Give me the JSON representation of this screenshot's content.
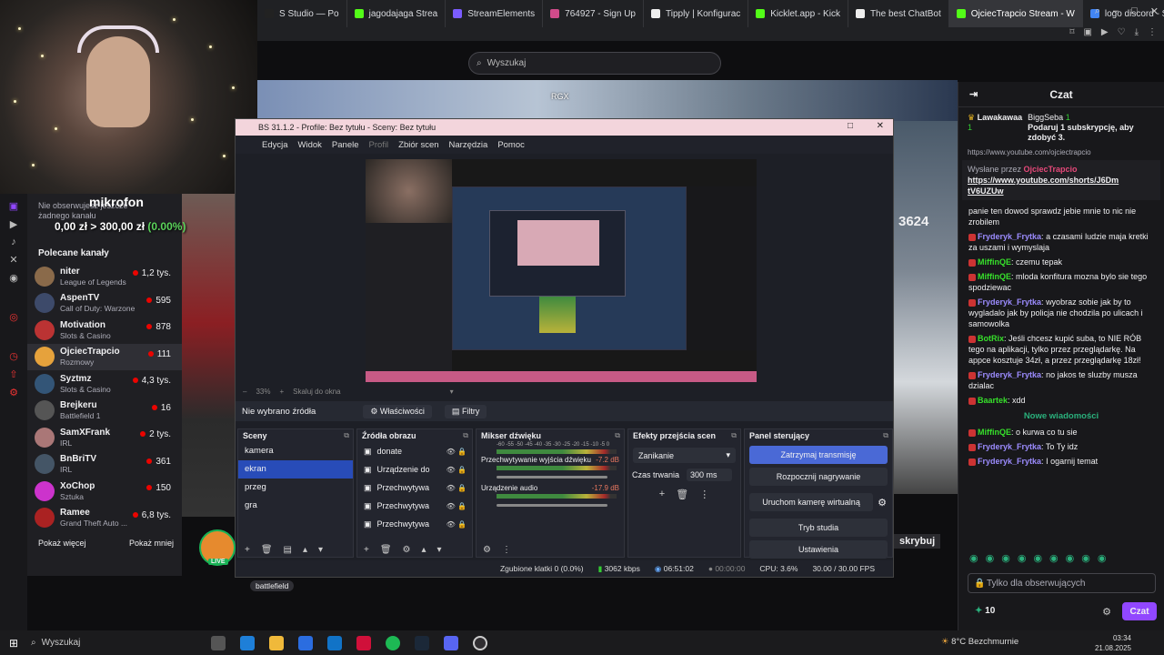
{
  "browser": {
    "tabs": [
      {
        "label": "S Studio — Po",
        "color": "#222"
      },
      {
        "label": "jagodajaga Strea",
        "color": "#53fc18"
      },
      {
        "label": "StreamElements",
        "color": "#7b5cff"
      },
      {
        "label": "764927 - Sign Up",
        "color": "#d04b8a"
      },
      {
        "label": "Tipply | Konfigurac",
        "color": "#eee"
      },
      {
        "label": "Kicklet.app - Kick",
        "color": "#53fc18"
      },
      {
        "label": "The best ChatBot",
        "color": "#eee"
      },
      {
        "label": "OjciecTrapcio Stream - W",
        "color": "#53fc18"
      },
      {
        "label": "logo discord - Sz",
        "color": "#4285f4"
      }
    ],
    "new_tab": "+"
  },
  "twitch": {
    "search_placeholder": "Wyszukaj",
    "mic_label": "mikrofon",
    "money": "0,00 zł > 300,00 zł",
    "money_pct": "(0.00%)",
    "not_following": "Nie obserwujesz jeszcze żadnego kanału",
    "recommended_title": "Polecane kanały",
    "channels": [
      {
        "name": "niter",
        "game": "League of Legends",
        "viewers": "1,2 tys.",
        "color": "#8a6a4a"
      },
      {
        "name": "AspenTV",
        "game": "Call of Duty: Warzone",
        "viewers": "595",
        "color": "#3d4a6a"
      },
      {
        "name": "Motivation",
        "game": "Slots & Casino",
        "viewers": "878",
        "color": "#b33"
      },
      {
        "name": "OjciecTrapcio",
        "game": "Rozmowy",
        "viewers": "111",
        "color": "#e6a23c"
      },
      {
        "name": "Syztmz",
        "game": "Slots & Casino",
        "viewers": "4,3 tys.",
        "color": "#357"
      },
      {
        "name": "Brejkeru",
        "game": "Battlefield 1",
        "viewers": "16",
        "color": "#555"
      },
      {
        "name": "SamXFrank",
        "game": "IRL",
        "viewers": "2 tys.",
        "color": "#a77"
      },
      {
        "name": "BnBriTV",
        "game": "IRL",
        "viewers": "361",
        "color": "#456"
      },
      {
        "name": "XoChop",
        "game": "Sztuka",
        "viewers": "150",
        "color": "#c3c"
      },
      {
        "name": "Ramee",
        "game": "Grand Theft Auto ...",
        "viewers": "6,8 tys.",
        "color": "#a22"
      }
    ],
    "show_more": "Pokaż więcej",
    "show_less": "Pokaż mniej",
    "rgx_label": "RGX",
    "counter": "3624",
    "subscribe_label": "skrybuj",
    "tag": "battlefield",
    "live": "LIVE"
  },
  "obs": {
    "title": "BS 31.1.2 - Profile: Bez tytułu - Sceny: Bez tytułu",
    "menu": [
      "Edycja",
      "Widok",
      "Panele",
      "Profil",
      "Zbiór scen",
      "Narzędzia",
      "Pomoc"
    ],
    "zoom": "33%",
    "fit": "Skaluj do okna",
    "no_source": "Nie wybrano źródła",
    "properties": "Właściwości",
    "filters": "Filtry",
    "scenes_title": "Sceny",
    "scenes": [
      "kamera",
      "ekran",
      "przeg",
      "gra"
    ],
    "selected_scene": "ekran",
    "sources_title": "Źródła obrazu",
    "sources": [
      "donate",
      "Urządzenie do",
      "Przechwytywa",
      "Przechwytywa",
      "Przechwytywa"
    ],
    "mixer_title": "Mikser dźwięku",
    "mixer_scale": "-60 -55 -50 -45 -40 -35 -30 -25 -20 -15 -10 -5 0",
    "mixer_tracks": [
      {
        "name": "Przechwytywanie wyjścia dźwięku",
        "db": "-7.2 dB"
      },
      {
        "name": "Urządzenie audio",
        "db": "-17.9 dB"
      }
    ],
    "transitions_title": "Efekty przejścia scen",
    "transition": "Zanikanie",
    "duration_label": "Czas trwania",
    "duration": "300 ms",
    "controls_title": "Panel sterujący",
    "controls": [
      "Zatrzymaj transmisję",
      "Rozpocznij nagrywanie",
      "Uruchom kamerę wirtualną",
      "Tryb studia",
      "Ustawienia"
    ],
    "status": {
      "dropped": "Zgubione klatki 0 (0.0%)",
      "bitrate": "3062 kbps",
      "stream_time": "06:51:02",
      "rec_time": "00:00:00",
      "cpu": "CPU: 3.6%",
      "fps": "30.00 / 30.00 FPS"
    }
  },
  "chat": {
    "title": "Czat",
    "top_gifter": "Lawakawaa",
    "top_count": "1",
    "gift_user": "BiggSeba",
    "gift_count": "1",
    "gift_text": "Podaruj 1 subskrypcję, aby zdobyć 3.",
    "link_top": "https://www.youtube.com/ojciectrapcio",
    "sent_by": "Wysłane przez",
    "sent_user": "OjciecTrapcio",
    "pinned_link": "https://www.youtube.com/shorts/J6Dm tV6UZUw",
    "messages": [
      {
        "user": "",
        "text": "panie ten dowod sprawdz jebie mnie to nic nie zrobilem",
        "color": "#efeff1"
      },
      {
        "user": "Fryderyk_Frytka",
        "text": "a czasami ludzie maja kretki za uszami i wymyslaja",
        "color": "#9c8cff"
      },
      {
        "user": "MiffinQE",
        "text": "czemu tepak",
        "color": "#37e02b"
      },
      {
        "user": "MiffinQE",
        "text": "mloda konfitura mozna bylo sie tego spodziewac",
        "color": "#37e02b"
      },
      {
        "user": "Fryderyk_Frytka",
        "text": "wyobraz sobie jak by to wygladalo jak by policja nie chodzila po ulicach i samowolka",
        "color": "#9c8cff"
      },
      {
        "user": "BotRix",
        "text": "Jeśli chcesz kupić suba, to NIE RÓB tego na aplikacji, tylko przez przeglądarkę. Na appce kosztuje 34zł, a przez przeglądarkę 18zł!",
        "color": "#37e02b"
      },
      {
        "user": "Fryderyk_Frytka",
        "text": "no jakos te sluzby musza dzialac",
        "color": "#9c8cff"
      },
      {
        "user": "Baartek",
        "text": "xdd",
        "color": "#37e02b"
      }
    ],
    "new_messages": "Nowe wiadomości",
    "new": [
      {
        "user": "MiffinQE",
        "text": "o kurwa co tu sie",
        "color": "#37e02b"
      },
      {
        "user": "Fryderyk_Frytka",
        "text": "To Ty idz",
        "color": "#9c8cff"
      },
      {
        "user": "Fryderyk_Frytka",
        "text": "I ogarnij temat",
        "color": "#9c8cff"
      }
    ],
    "input_placeholder": "Tylko dla obserwujących",
    "points": "10",
    "send": "Czat"
  },
  "taskbar": {
    "search": "Wyszukaj",
    "weather": "8°C  Bezchmurnie",
    "time": "03:34",
    "date": "21.08.2025"
  }
}
